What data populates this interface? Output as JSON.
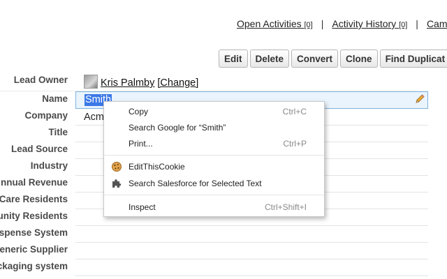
{
  "related_links": [
    {
      "label": "Open Activities",
      "count": "[0]"
    },
    {
      "label": "Activity History",
      "count": "[0]"
    },
    {
      "label": "Camp",
      "count": ""
    }
  ],
  "link_separator": "|",
  "buttons": {
    "edit": "Edit",
    "delete": "Delete",
    "convert": "Convert",
    "clone": "Clone",
    "find_duplicates": "Find Duplicat"
  },
  "fields": {
    "lead_owner": {
      "label": "Lead Owner",
      "value": "Kris Palmby",
      "action": "[Change]"
    },
    "name": {
      "label": "Name",
      "value": "Smith"
    },
    "company": {
      "label": "Company",
      "value": "Acm"
    },
    "title": {
      "label": "Title"
    },
    "lead_source": {
      "label": "Lead Source"
    },
    "industry": {
      "label": "Industry"
    },
    "annual_revenue": {
      "label": "nnual Revenue"
    },
    "care_residents": {
      "label": "Care Residents"
    },
    "unity_residents": {
      "label": "unity Residents"
    },
    "dispense_system": {
      "label": "spense System"
    },
    "generic_supplier": {
      "label": "eneric Supplier"
    },
    "packaging_system": {
      "label": "ckaging system"
    }
  },
  "context_menu": {
    "copy": {
      "label": "Copy",
      "shortcut": "Ctrl+C"
    },
    "search_google": {
      "label": "Search Google for “Smith”"
    },
    "print": {
      "label": "Print...",
      "shortcut": "Ctrl+P"
    },
    "edit_this_cookie": {
      "label": "EditThisCookie",
      "icon": "cookie-icon"
    },
    "search_salesforce": {
      "label": "Search Salesforce for Selected Text",
      "icon": "puzzle-icon"
    },
    "inspect": {
      "label": "Inspect",
      "shortcut": "Ctrl+Shift+I"
    }
  },
  "colors": {
    "selection": "#3b78e7",
    "field_highlight": "#eaf4fd",
    "field_border": "#7ab3e0"
  }
}
